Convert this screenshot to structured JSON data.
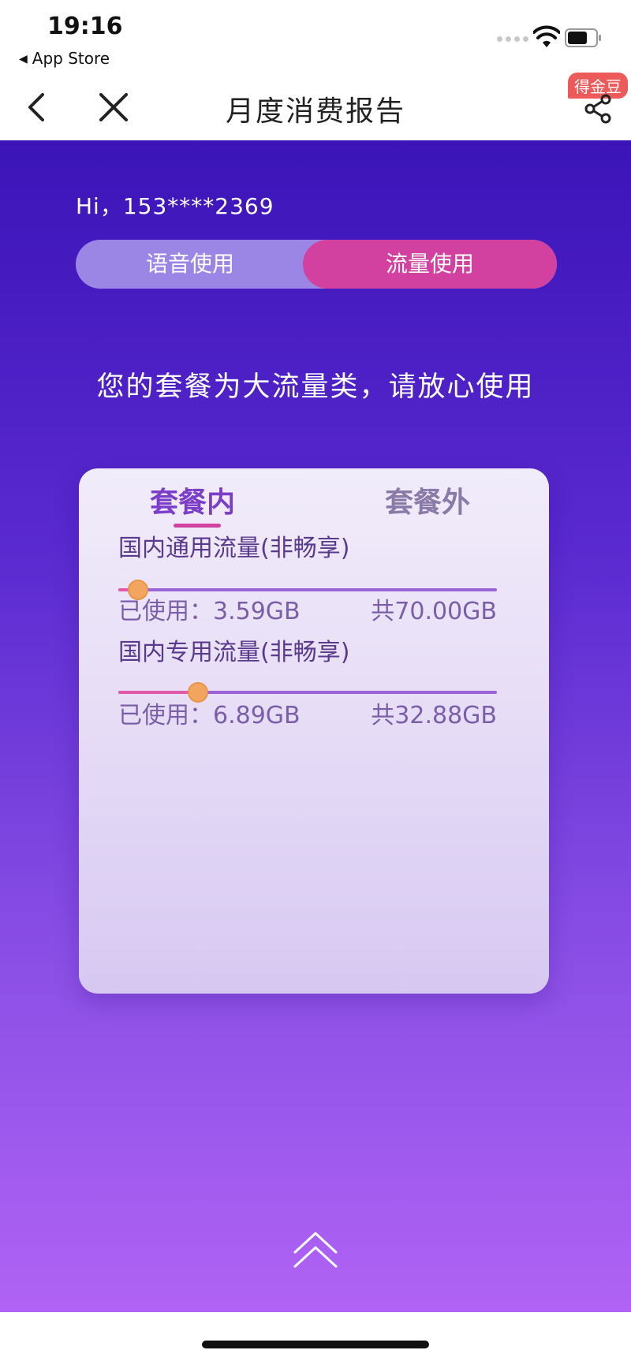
{
  "status_bar": {
    "time": "19:16",
    "back_label": "App Store"
  },
  "nav": {
    "title": "月度消费报告",
    "badge": "得金豆"
  },
  "greeting": "Hi，153****2369",
  "toggle": {
    "voice_label": "语音使用",
    "data_label": "流量使用",
    "selected": "流量使用"
  },
  "headline": "您的套餐为大流量类，请放心使用",
  "tabs": {
    "in_plan": "套餐内",
    "out_plan": "套餐外",
    "selected": "套餐内"
  },
  "usage": [
    {
      "title": "国内通用流量(非畅享)",
      "used_label": "已使用：3.59GB",
      "total_label": "共70.00GB",
      "used_gb": 3.59,
      "total_gb": 70.0
    },
    {
      "title": "国内专用流量(非畅享)",
      "used_label": "已使用：6.89GB",
      "total_label": "共32.88GB",
      "used_gb": 6.89,
      "total_gb": 32.88
    }
  ],
  "colors": {
    "accent_pink": "#d2419f",
    "knob_orange": "#f2a55e",
    "gradient_top": "#3b14b8",
    "gradient_bottom": "#b063f4"
  },
  "icons": [
    "back-chevron-icon",
    "close-icon",
    "share-icon",
    "wifi-icon",
    "battery-icon",
    "double-chevron-up-icon"
  ]
}
